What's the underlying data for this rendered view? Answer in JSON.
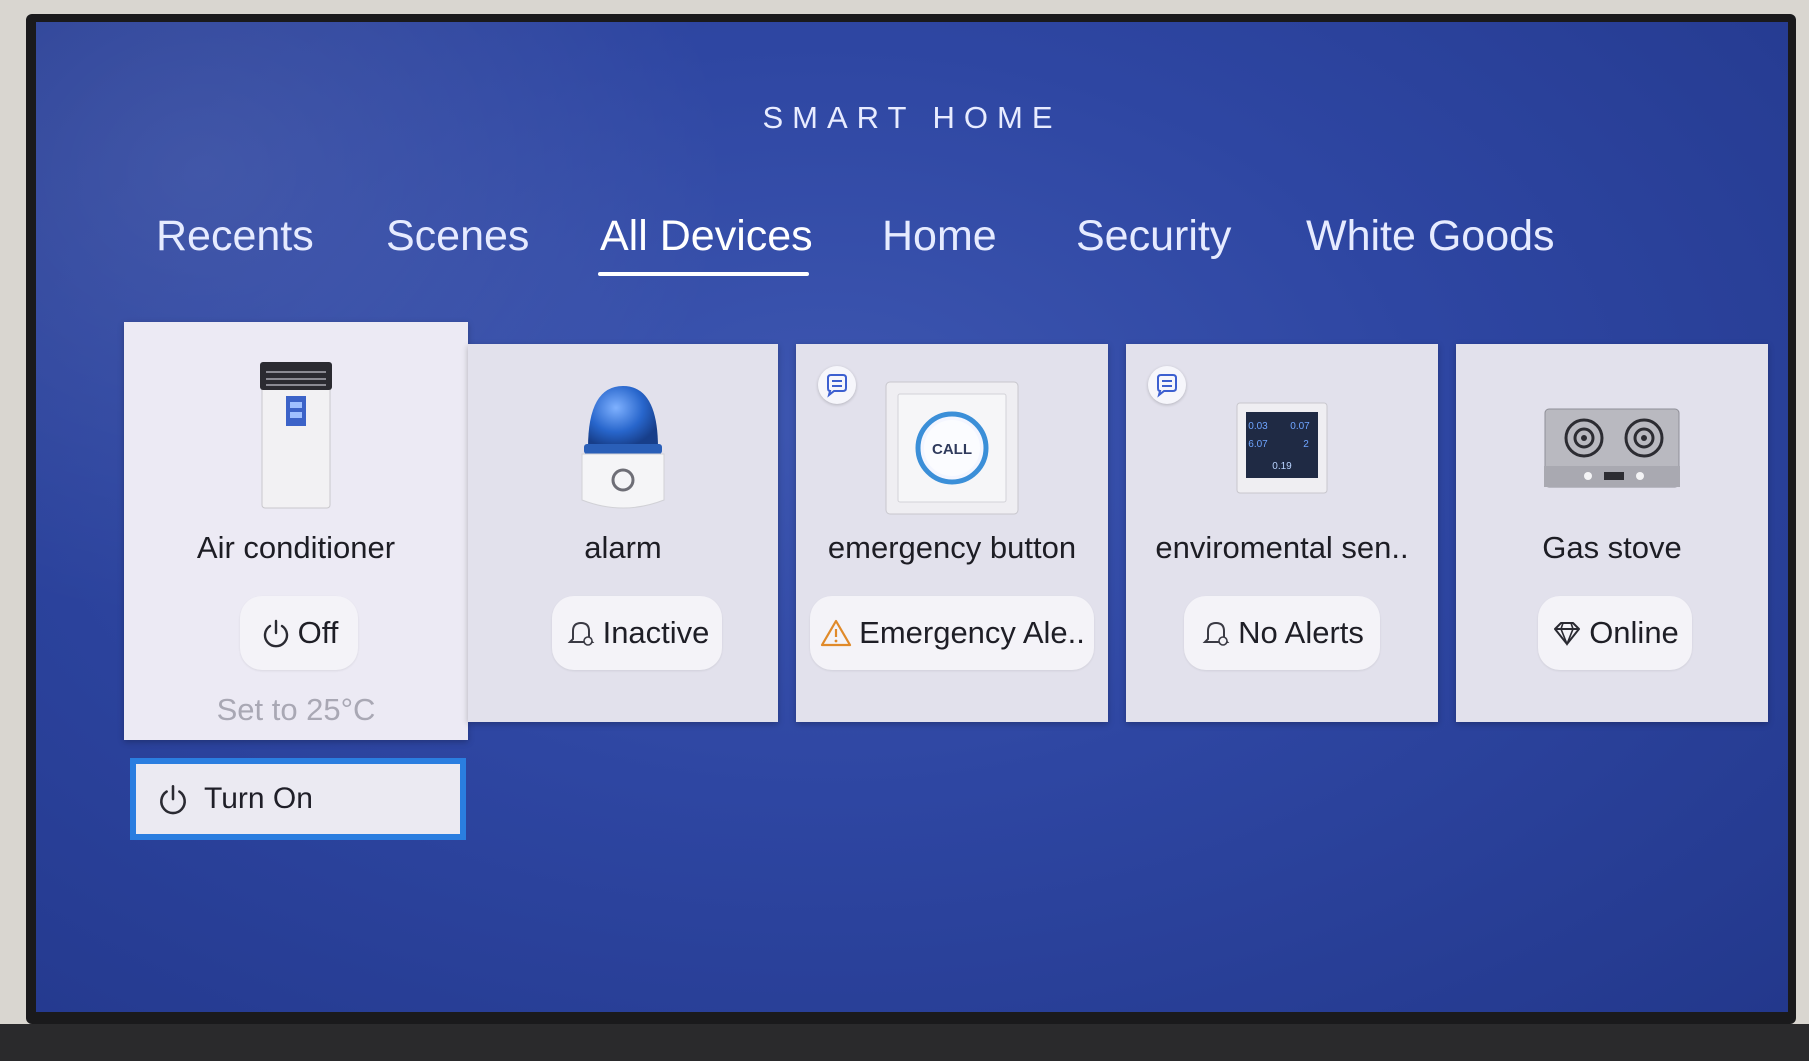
{
  "header": {
    "title": "SMART HOME"
  },
  "tabs": [
    {
      "label": "Recents"
    },
    {
      "label": "Scenes"
    },
    {
      "label": "All Devices"
    },
    {
      "label": "Home"
    },
    {
      "label": "Security"
    },
    {
      "label": "White Goods"
    }
  ],
  "active_tab": "All Devices",
  "devices": [
    {
      "name": "Air conditioner",
      "status": "Off",
      "status_icon": "power-icon",
      "detail": "Set to 25°C",
      "action": "Turn On",
      "action_icon": "power-icon",
      "icon": "air-conditioner-icon"
    },
    {
      "name": "alarm",
      "status": "Inactive",
      "status_icon": "bell-icon",
      "icon": "alarm-siren-icon"
    },
    {
      "name": "emergency button",
      "status": "Emergency Ale..",
      "status_icon": "warning-triangle-icon",
      "icon": "call-button-icon",
      "button_text": "CALL"
    },
    {
      "name": "enviromental sen..",
      "status": "No Alerts",
      "status_icon": "bell-icon",
      "icon": "environment-sensor-icon",
      "display_values": [
        "0.03",
        "0.07",
        "6.07",
        "2",
        "0.19"
      ]
    },
    {
      "name": "Gas stove",
      "status": "Online",
      "status_icon": "diamond-icon",
      "icon": "gas-stove-icon"
    }
  ],
  "colors": {
    "background": "#2e46a2",
    "card": "#e2e1ec",
    "focus_border": "#2a7ee0",
    "warning": "#e08a2a"
  }
}
